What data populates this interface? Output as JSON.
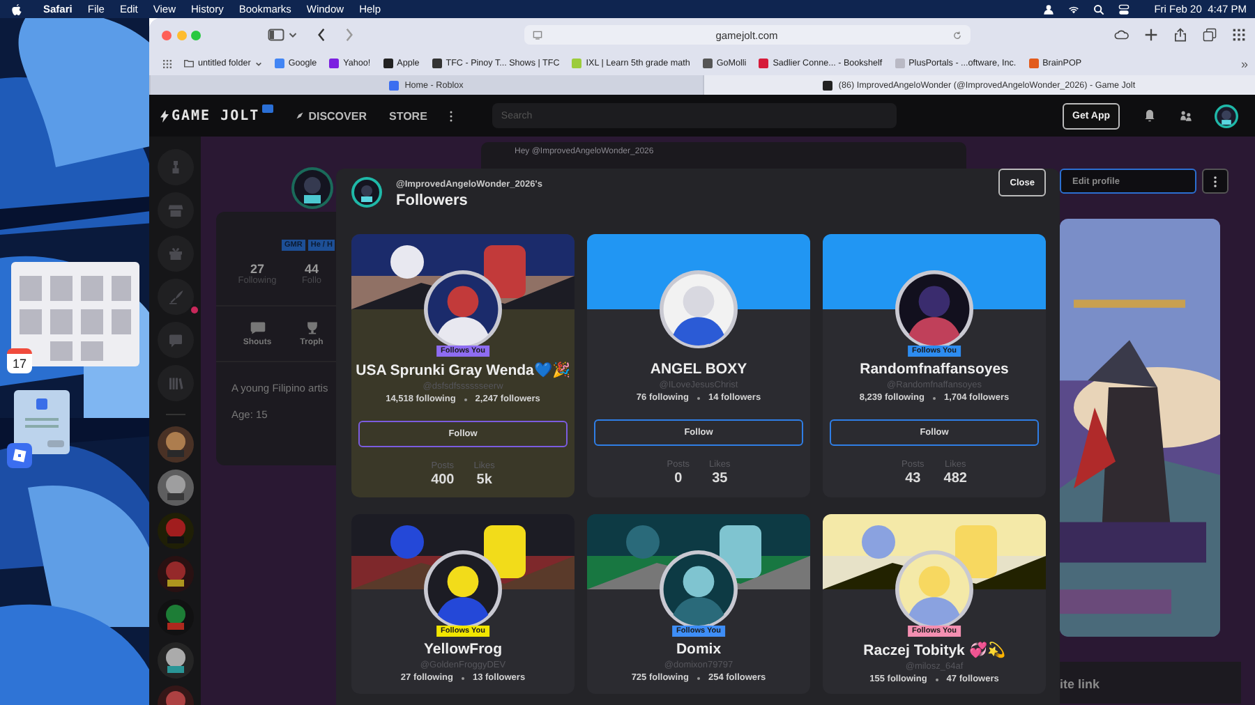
{
  "menu_bar": {
    "app": "Safari",
    "menus": [
      "File",
      "Edit",
      "View",
      "History",
      "Bookmarks",
      "Window",
      "Help"
    ],
    "clock": "Fri Feb 20  4:47 PM"
  },
  "desktop": {
    "calendar_day": "17"
  },
  "browser": {
    "address": "gamejolt.com",
    "bookmarks": [
      {
        "label": "untitled folder",
        "kind": "folder"
      },
      {
        "label": "Google",
        "kind": "link"
      },
      {
        "label": "Yahoo!",
        "kind": "link"
      },
      {
        "label": "Apple",
        "kind": "link"
      },
      {
        "label": "TFC - Pinoy T... Shows | TFC",
        "kind": "link"
      },
      {
        "label": "IXL | Learn 5th grade math",
        "kind": "link"
      },
      {
        "label": "GoMolli",
        "kind": "link"
      },
      {
        "label": "Sadlier Conne... - Bookshelf",
        "kind": "link"
      },
      {
        "label": "PlusPortals - ...oftware, Inc.",
        "kind": "link"
      },
      {
        "label": "BrainPOP",
        "kind": "link"
      }
    ],
    "more": "»",
    "tabs": [
      {
        "title": "Home - Roblox",
        "selected": false
      },
      {
        "title": "(86) ImprovedAngeloWonder (@ImprovedAngeloWonder_2026) - Game Jolt",
        "selected": true
      }
    ]
  },
  "site_header": {
    "logo": "GAME JOLT",
    "nav": [
      "DISCOVER",
      "STORE"
    ],
    "search": {
      "placeholder": "Search"
    },
    "get_app": "Get App"
  },
  "sidebar": {
    "icons": [
      {
        "notification": false
      },
      {
        "notification": false
      },
      {
        "notification": false
      },
      {
        "notification": true
      },
      {
        "notification": false
      },
      {
        "notification": false
      }
    ]
  },
  "profile": {
    "post_prompt": "Hey @ImprovedAngeloWonder_2026",
    "tags": [
      "GMR",
      "He / H"
    ],
    "stats": [
      {
        "value": "27",
        "label": "Following"
      },
      {
        "value": "44",
        "label": "Follo"
      }
    ],
    "tabs": [
      "Shouts",
      "Troph"
    ],
    "bio": "A young Filipino artis",
    "age": "Age: 15",
    "edit": "Edit profile",
    "link": "ite link"
  },
  "modal": {
    "owner": "@ImprovedAngeloWonder_2026's",
    "title": "Followers",
    "close": "Close",
    "cards": [
      {
        "name": "USA Sprunki Gray Wenda💙🎉",
        "handle": "@dsfsdfsssssseerw",
        "following": "14,518 following",
        "followers": "2,247 followers",
        "follows_you": true,
        "badge": {
          "text": "Follows You",
          "color": "#8e6cf2"
        },
        "highlighted": true,
        "button": {
          "label": "Follow",
          "color": "#7b5ce0"
        },
        "stats": [
          {
            "label": "Posts",
            "value": "400"
          },
          {
            "label": "Likes",
            "value": "5k"
          }
        ]
      },
      {
        "name": "ANGEL BOXY",
        "handle": "@ILoveJesusChrist",
        "following": "76 following",
        "followers": "14 followers",
        "follows_you": false,
        "banner": {
          "kind": "color",
          "color": "#2196f3"
        },
        "highlighted": false,
        "button": {
          "label": "Follow",
          "color": "#2f7ee6"
        },
        "stats": [
          {
            "label": "Posts",
            "value": "0"
          },
          {
            "label": "Likes",
            "value": "35"
          }
        ]
      },
      {
        "name": "Randomfnaffansoyes",
        "handle": "@Randomfnaffansoyes",
        "following": "8,239 following",
        "followers": "1,704 followers",
        "follows_you": true,
        "badge": {
          "text": "Follows You",
          "color": "#2d8cf0"
        },
        "banner": {
          "kind": "color",
          "color": "#2196f3"
        },
        "highlighted": false,
        "button": {
          "label": "Follow",
          "color": "#2f7ee6"
        },
        "stats": [
          {
            "label": "Posts",
            "value": "43"
          },
          {
            "label": "Likes",
            "value": "482"
          }
        ]
      },
      {
        "name": "YellowFrog",
        "handle": "@GoldenFroggyDEV",
        "following": "27 following",
        "followers": "13 followers",
        "follows_you": true,
        "badge": {
          "text": "Follows You",
          "color": "#f2e600"
        },
        "highlighted": false
      },
      {
        "name": "Domix",
        "handle": "@domixon79797",
        "following": "725 following",
        "followers": "254 followers",
        "follows_you": true,
        "badge": {
          "text": "Follows You",
          "color": "#3e8ef7"
        },
        "highlighted": false
      },
      {
        "name": "Raczej Tobityk 💞💫",
        "handle": "@milosz_64af",
        "following": "155 following",
        "followers": "47 followers",
        "follows_you": true,
        "badge": {
          "text": "Follows You",
          "color": "#f48fb1"
        },
        "highlighted": false
      }
    ]
  }
}
